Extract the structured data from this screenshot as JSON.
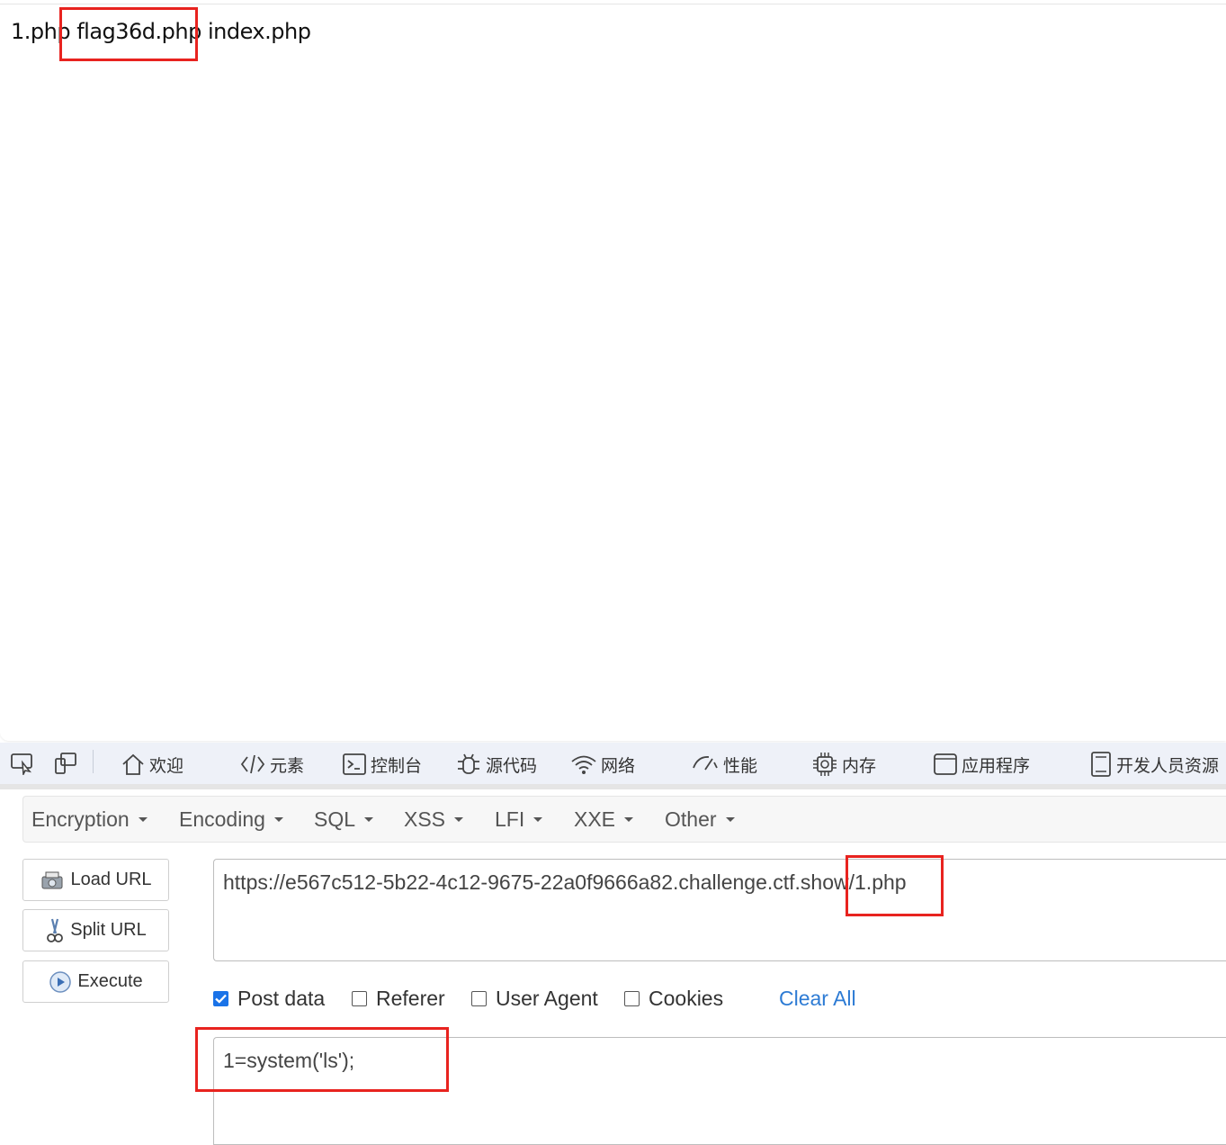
{
  "page": {
    "output_text": "1.php flag36d.php index.php"
  },
  "devtools": {
    "tabs": [
      {
        "label": "欢迎",
        "icon": "home-icon"
      },
      {
        "label": "元素",
        "icon": "code-icon"
      },
      {
        "label": "控制台",
        "icon": "console-icon"
      },
      {
        "label": "源代码",
        "icon": "bug-icon"
      },
      {
        "label": "网络",
        "icon": "wifi-icon"
      },
      {
        "label": "性能",
        "icon": "gauge-icon"
      },
      {
        "label": "内存",
        "icon": "chip-icon"
      },
      {
        "label": "应用程序",
        "icon": "window-icon"
      },
      {
        "label": "开发人员资源",
        "icon": "document-icon"
      }
    ]
  },
  "hackbar": {
    "menu": [
      "Encryption",
      "Encoding",
      "SQL",
      "XSS",
      "LFI",
      "XXE",
      "Other"
    ],
    "buttons": {
      "load_url": "Load URL",
      "split_url": "Split URL",
      "execute": "Execute"
    },
    "url": "https://e567c512-5b22-4c12-9675-22a0f9666a82.challenge.ctf.show/1.php",
    "options": {
      "post_data": {
        "label": "Post data",
        "checked": true
      },
      "referer": {
        "label": "Referer",
        "checked": false
      },
      "user_agent": {
        "label": "User Agent",
        "checked": false
      },
      "cookies": {
        "label": "Cookies",
        "checked": false
      }
    },
    "clear_all": "Clear All",
    "post_body": "1=system('ls');"
  },
  "colors": {
    "highlight": "#e8231f",
    "link": "#2d7bd4",
    "checkbox": "#1a73e8"
  }
}
